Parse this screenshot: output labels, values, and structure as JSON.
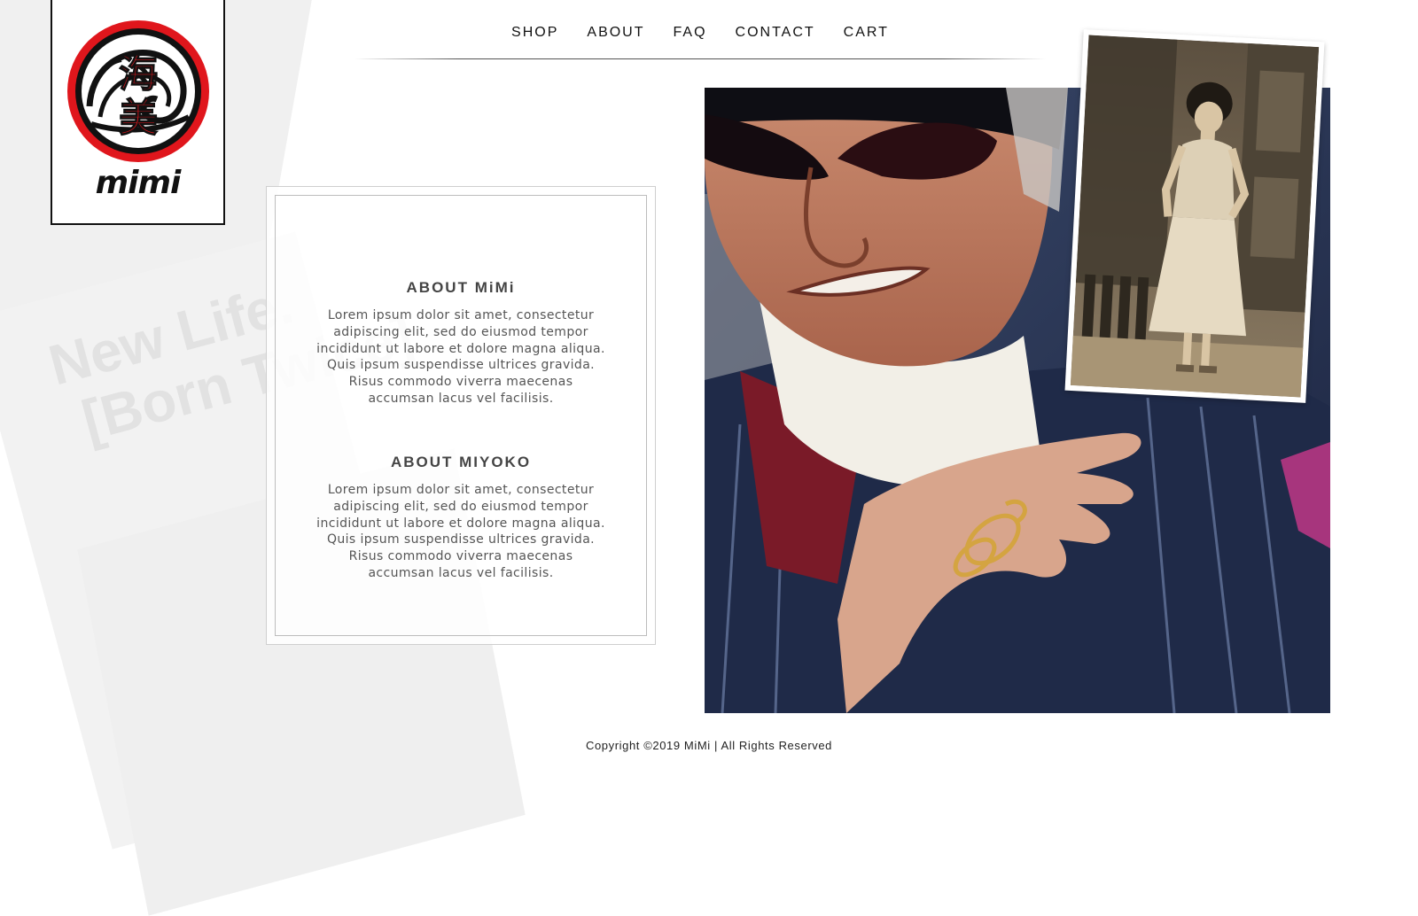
{
  "brand": {
    "logo_kanji_top": "海",
    "logo_kanji_bottom": "美",
    "logo_word": "mimi",
    "accent_color": "#e0161c"
  },
  "nav": {
    "items": [
      {
        "label": "SHOP"
      },
      {
        "label": "ABOUT"
      },
      {
        "label": "FAQ"
      },
      {
        "label": "CONTACT"
      },
      {
        "label": "CART"
      }
    ]
  },
  "background": {
    "tagline_line1": "New Life.",
    "tagline_line2": "[Born Twice]"
  },
  "sections": [
    {
      "heading": "ABOUT MiMi",
      "body": "Lorem ipsum dolor sit amet, consectetur adipiscing elit, sed do eiusmod tempor incididunt ut labore et dolore magna aliqua. Quis ipsum suspendisse ultrices gravida. Risus commodo viverra maecenas accumsan lacus vel facilisis."
    },
    {
      "heading": "ABOUT MIYOKO",
      "body": "Lorem ipsum dolor sit amet, consectetur adipiscing elit, sed do eiusmod tempor incididunt ut labore et dolore magna aliqua. Quis ipsum suspendisse ultrices gravida. Risus commodo viverra maecenas accumsan lacus vel facilisis."
    }
  ],
  "footer": {
    "copyright": "Copyright ©2019 MiMi | All Rights Reserved"
  }
}
